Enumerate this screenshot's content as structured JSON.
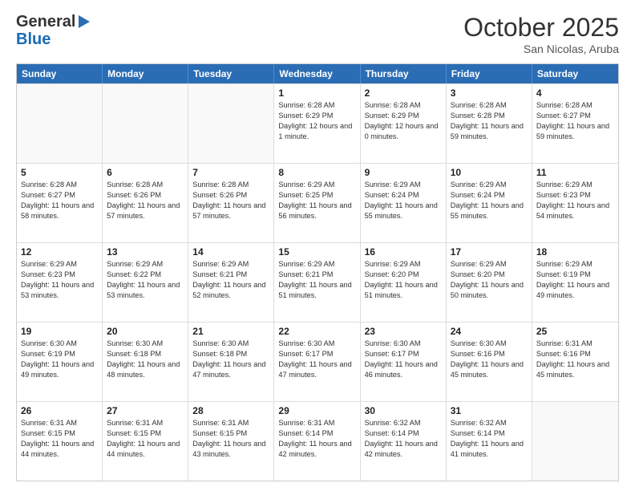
{
  "logo": {
    "line1": "General",
    "line2": "Blue"
  },
  "title": "October 2025",
  "subtitle": "San Nicolas, Aruba",
  "headers": [
    "Sunday",
    "Monday",
    "Tuesday",
    "Wednesday",
    "Thursday",
    "Friday",
    "Saturday"
  ],
  "weeks": [
    [
      {
        "day": "",
        "sunrise": "",
        "sunset": "",
        "daylight": ""
      },
      {
        "day": "",
        "sunrise": "",
        "sunset": "",
        "daylight": ""
      },
      {
        "day": "",
        "sunrise": "",
        "sunset": "",
        "daylight": ""
      },
      {
        "day": "1",
        "sunrise": "Sunrise: 6:28 AM",
        "sunset": "Sunset: 6:29 PM",
        "daylight": "Daylight: 12 hours and 1 minute."
      },
      {
        "day": "2",
        "sunrise": "Sunrise: 6:28 AM",
        "sunset": "Sunset: 6:29 PM",
        "daylight": "Daylight: 12 hours and 0 minutes."
      },
      {
        "day": "3",
        "sunrise": "Sunrise: 6:28 AM",
        "sunset": "Sunset: 6:28 PM",
        "daylight": "Daylight: 11 hours and 59 minutes."
      },
      {
        "day": "4",
        "sunrise": "Sunrise: 6:28 AM",
        "sunset": "Sunset: 6:27 PM",
        "daylight": "Daylight: 11 hours and 59 minutes."
      }
    ],
    [
      {
        "day": "5",
        "sunrise": "Sunrise: 6:28 AM",
        "sunset": "Sunset: 6:27 PM",
        "daylight": "Daylight: 11 hours and 58 minutes."
      },
      {
        "day": "6",
        "sunrise": "Sunrise: 6:28 AM",
        "sunset": "Sunset: 6:26 PM",
        "daylight": "Daylight: 11 hours and 57 minutes."
      },
      {
        "day": "7",
        "sunrise": "Sunrise: 6:28 AM",
        "sunset": "Sunset: 6:26 PM",
        "daylight": "Daylight: 11 hours and 57 minutes."
      },
      {
        "day": "8",
        "sunrise": "Sunrise: 6:29 AM",
        "sunset": "Sunset: 6:25 PM",
        "daylight": "Daylight: 11 hours and 56 minutes."
      },
      {
        "day": "9",
        "sunrise": "Sunrise: 6:29 AM",
        "sunset": "Sunset: 6:24 PM",
        "daylight": "Daylight: 11 hours and 55 minutes."
      },
      {
        "day": "10",
        "sunrise": "Sunrise: 6:29 AM",
        "sunset": "Sunset: 6:24 PM",
        "daylight": "Daylight: 11 hours and 55 minutes."
      },
      {
        "day": "11",
        "sunrise": "Sunrise: 6:29 AM",
        "sunset": "Sunset: 6:23 PM",
        "daylight": "Daylight: 11 hours and 54 minutes."
      }
    ],
    [
      {
        "day": "12",
        "sunrise": "Sunrise: 6:29 AM",
        "sunset": "Sunset: 6:23 PM",
        "daylight": "Daylight: 11 hours and 53 minutes."
      },
      {
        "day": "13",
        "sunrise": "Sunrise: 6:29 AM",
        "sunset": "Sunset: 6:22 PM",
        "daylight": "Daylight: 11 hours and 53 minutes."
      },
      {
        "day": "14",
        "sunrise": "Sunrise: 6:29 AM",
        "sunset": "Sunset: 6:21 PM",
        "daylight": "Daylight: 11 hours and 52 minutes."
      },
      {
        "day": "15",
        "sunrise": "Sunrise: 6:29 AM",
        "sunset": "Sunset: 6:21 PM",
        "daylight": "Daylight: 11 hours and 51 minutes."
      },
      {
        "day": "16",
        "sunrise": "Sunrise: 6:29 AM",
        "sunset": "Sunset: 6:20 PM",
        "daylight": "Daylight: 11 hours and 51 minutes."
      },
      {
        "day": "17",
        "sunrise": "Sunrise: 6:29 AM",
        "sunset": "Sunset: 6:20 PM",
        "daylight": "Daylight: 11 hours and 50 minutes."
      },
      {
        "day": "18",
        "sunrise": "Sunrise: 6:29 AM",
        "sunset": "Sunset: 6:19 PM",
        "daylight": "Daylight: 11 hours and 49 minutes."
      }
    ],
    [
      {
        "day": "19",
        "sunrise": "Sunrise: 6:30 AM",
        "sunset": "Sunset: 6:19 PM",
        "daylight": "Daylight: 11 hours and 49 minutes."
      },
      {
        "day": "20",
        "sunrise": "Sunrise: 6:30 AM",
        "sunset": "Sunset: 6:18 PM",
        "daylight": "Daylight: 11 hours and 48 minutes."
      },
      {
        "day": "21",
        "sunrise": "Sunrise: 6:30 AM",
        "sunset": "Sunset: 6:18 PM",
        "daylight": "Daylight: 11 hours and 47 minutes."
      },
      {
        "day": "22",
        "sunrise": "Sunrise: 6:30 AM",
        "sunset": "Sunset: 6:17 PM",
        "daylight": "Daylight: 11 hours and 47 minutes."
      },
      {
        "day": "23",
        "sunrise": "Sunrise: 6:30 AM",
        "sunset": "Sunset: 6:17 PM",
        "daylight": "Daylight: 11 hours and 46 minutes."
      },
      {
        "day": "24",
        "sunrise": "Sunrise: 6:30 AM",
        "sunset": "Sunset: 6:16 PM",
        "daylight": "Daylight: 11 hours and 45 minutes."
      },
      {
        "day": "25",
        "sunrise": "Sunrise: 6:31 AM",
        "sunset": "Sunset: 6:16 PM",
        "daylight": "Daylight: 11 hours and 45 minutes."
      }
    ],
    [
      {
        "day": "26",
        "sunrise": "Sunrise: 6:31 AM",
        "sunset": "Sunset: 6:15 PM",
        "daylight": "Daylight: 11 hours and 44 minutes."
      },
      {
        "day": "27",
        "sunrise": "Sunrise: 6:31 AM",
        "sunset": "Sunset: 6:15 PM",
        "daylight": "Daylight: 11 hours and 44 minutes."
      },
      {
        "day": "28",
        "sunrise": "Sunrise: 6:31 AM",
        "sunset": "Sunset: 6:15 PM",
        "daylight": "Daylight: 11 hours and 43 minutes."
      },
      {
        "day": "29",
        "sunrise": "Sunrise: 6:31 AM",
        "sunset": "Sunset: 6:14 PM",
        "daylight": "Daylight: 11 hours and 42 minutes."
      },
      {
        "day": "30",
        "sunrise": "Sunrise: 6:32 AM",
        "sunset": "Sunset: 6:14 PM",
        "daylight": "Daylight: 11 hours and 42 minutes."
      },
      {
        "day": "31",
        "sunrise": "Sunrise: 6:32 AM",
        "sunset": "Sunset: 6:14 PM",
        "daylight": "Daylight: 11 hours and 41 minutes."
      },
      {
        "day": "",
        "sunrise": "",
        "sunset": "",
        "daylight": ""
      }
    ]
  ]
}
